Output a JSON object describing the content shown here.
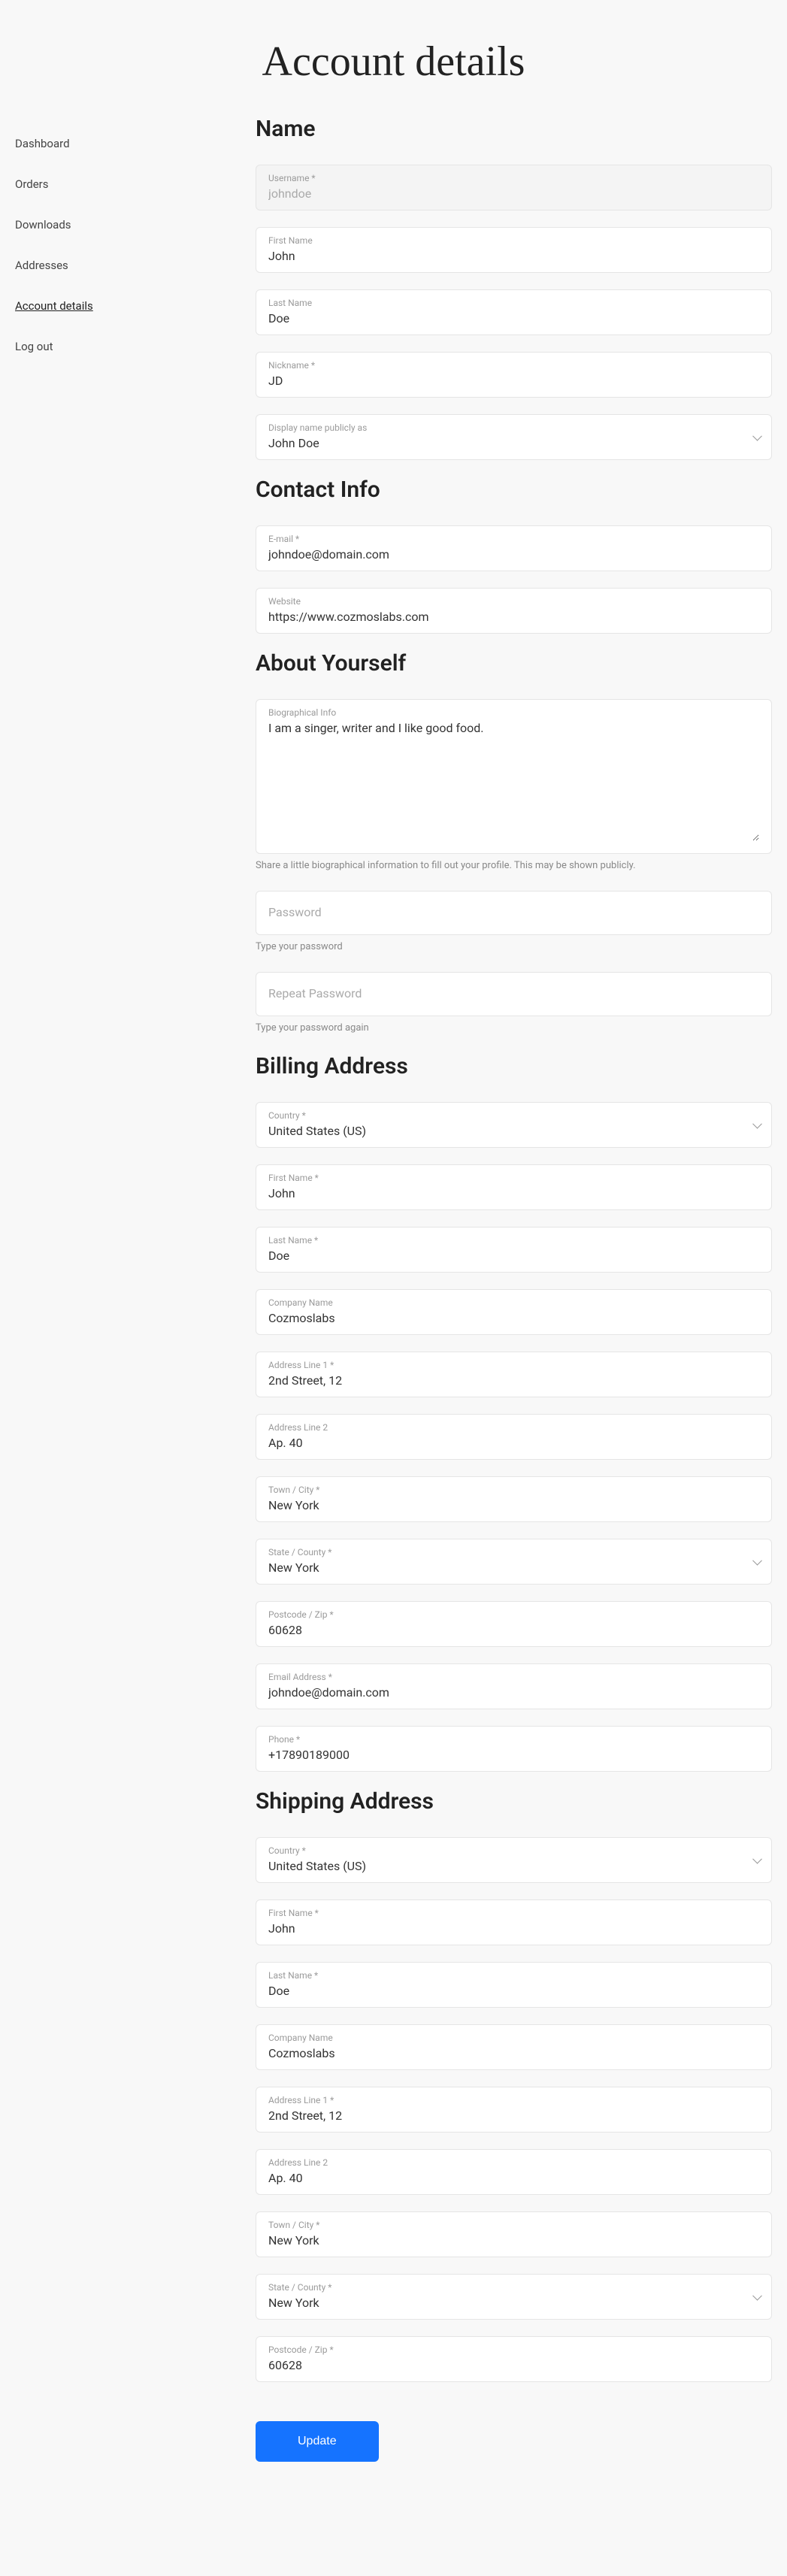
{
  "page_title": "Account details",
  "sidebar": {
    "items": [
      {
        "label": "Dashboard"
      },
      {
        "label": "Orders"
      },
      {
        "label": "Downloads"
      },
      {
        "label": "Addresses"
      },
      {
        "label": "Account details"
      },
      {
        "label": "Log out"
      }
    ]
  },
  "sections": {
    "name": {
      "title": "Name",
      "username": {
        "label": "Username *",
        "value": "johndoe"
      },
      "first_name": {
        "label": "First Name",
        "value": "John"
      },
      "last_name": {
        "label": "Last Name",
        "value": "Doe"
      },
      "nickname": {
        "label": "Nickname *",
        "value": "JD"
      },
      "display_name": {
        "label": "Display name publicly as",
        "value": "John Doe"
      }
    },
    "contact": {
      "title": "Contact Info",
      "email": {
        "label": "E-mail *",
        "value": "johndoe@domain.com"
      },
      "website": {
        "label": "Website",
        "value": "https://www.cozmoslabs.com"
      }
    },
    "about": {
      "title": "About Yourself",
      "bio": {
        "label": "Biographical Info",
        "value": "I am a singer, writer and I like good food."
      },
      "bio_helper": "Share a little biographical information to fill out your profile. This may be shown publicly.",
      "password": {
        "placeholder": "Password",
        "helper": "Type your password"
      },
      "repeat_password": {
        "placeholder": "Repeat Password",
        "helper": "Type your password again"
      }
    },
    "billing": {
      "title": "Billing Address",
      "country": {
        "label": "Country *",
        "value": "United States (US)"
      },
      "first_name": {
        "label": "First Name *",
        "value": "John"
      },
      "last_name": {
        "label": "Last Name *",
        "value": "Doe"
      },
      "company": {
        "label": "Company Name",
        "value": "Cozmoslabs"
      },
      "addr1": {
        "label": "Address Line 1 *",
        "value": "2nd Street, 12"
      },
      "addr2": {
        "label": "Address Line 2",
        "value": "Ap. 40"
      },
      "city": {
        "label": "Town / City *",
        "value": "New York"
      },
      "state": {
        "label": "State / County *",
        "value": "New York"
      },
      "zip": {
        "label": "Postcode / Zip *",
        "value": "60628"
      },
      "email": {
        "label": "Email Address *",
        "value": "johndoe@domain.com"
      },
      "phone": {
        "label": "Phone *",
        "value": "+17890189000"
      }
    },
    "shipping": {
      "title": "Shipping Address",
      "country": {
        "label": "Country *",
        "value": "United States (US)"
      },
      "first_name": {
        "label": "First Name *",
        "value": "John"
      },
      "last_name": {
        "label": "Last Name *",
        "value": "Doe"
      },
      "company": {
        "label": "Company Name",
        "value": "Cozmoslabs"
      },
      "addr1": {
        "label": "Address Line 1 *",
        "value": "2nd Street, 12"
      },
      "addr2": {
        "label": "Address Line 2",
        "value": "Ap. 40"
      },
      "city": {
        "label": "Town / City *",
        "value": "New York"
      },
      "state": {
        "label": "State / County *",
        "value": "New York"
      },
      "zip": {
        "label": "Postcode / Zip *",
        "value": "60628"
      }
    }
  },
  "update_button": "Update"
}
